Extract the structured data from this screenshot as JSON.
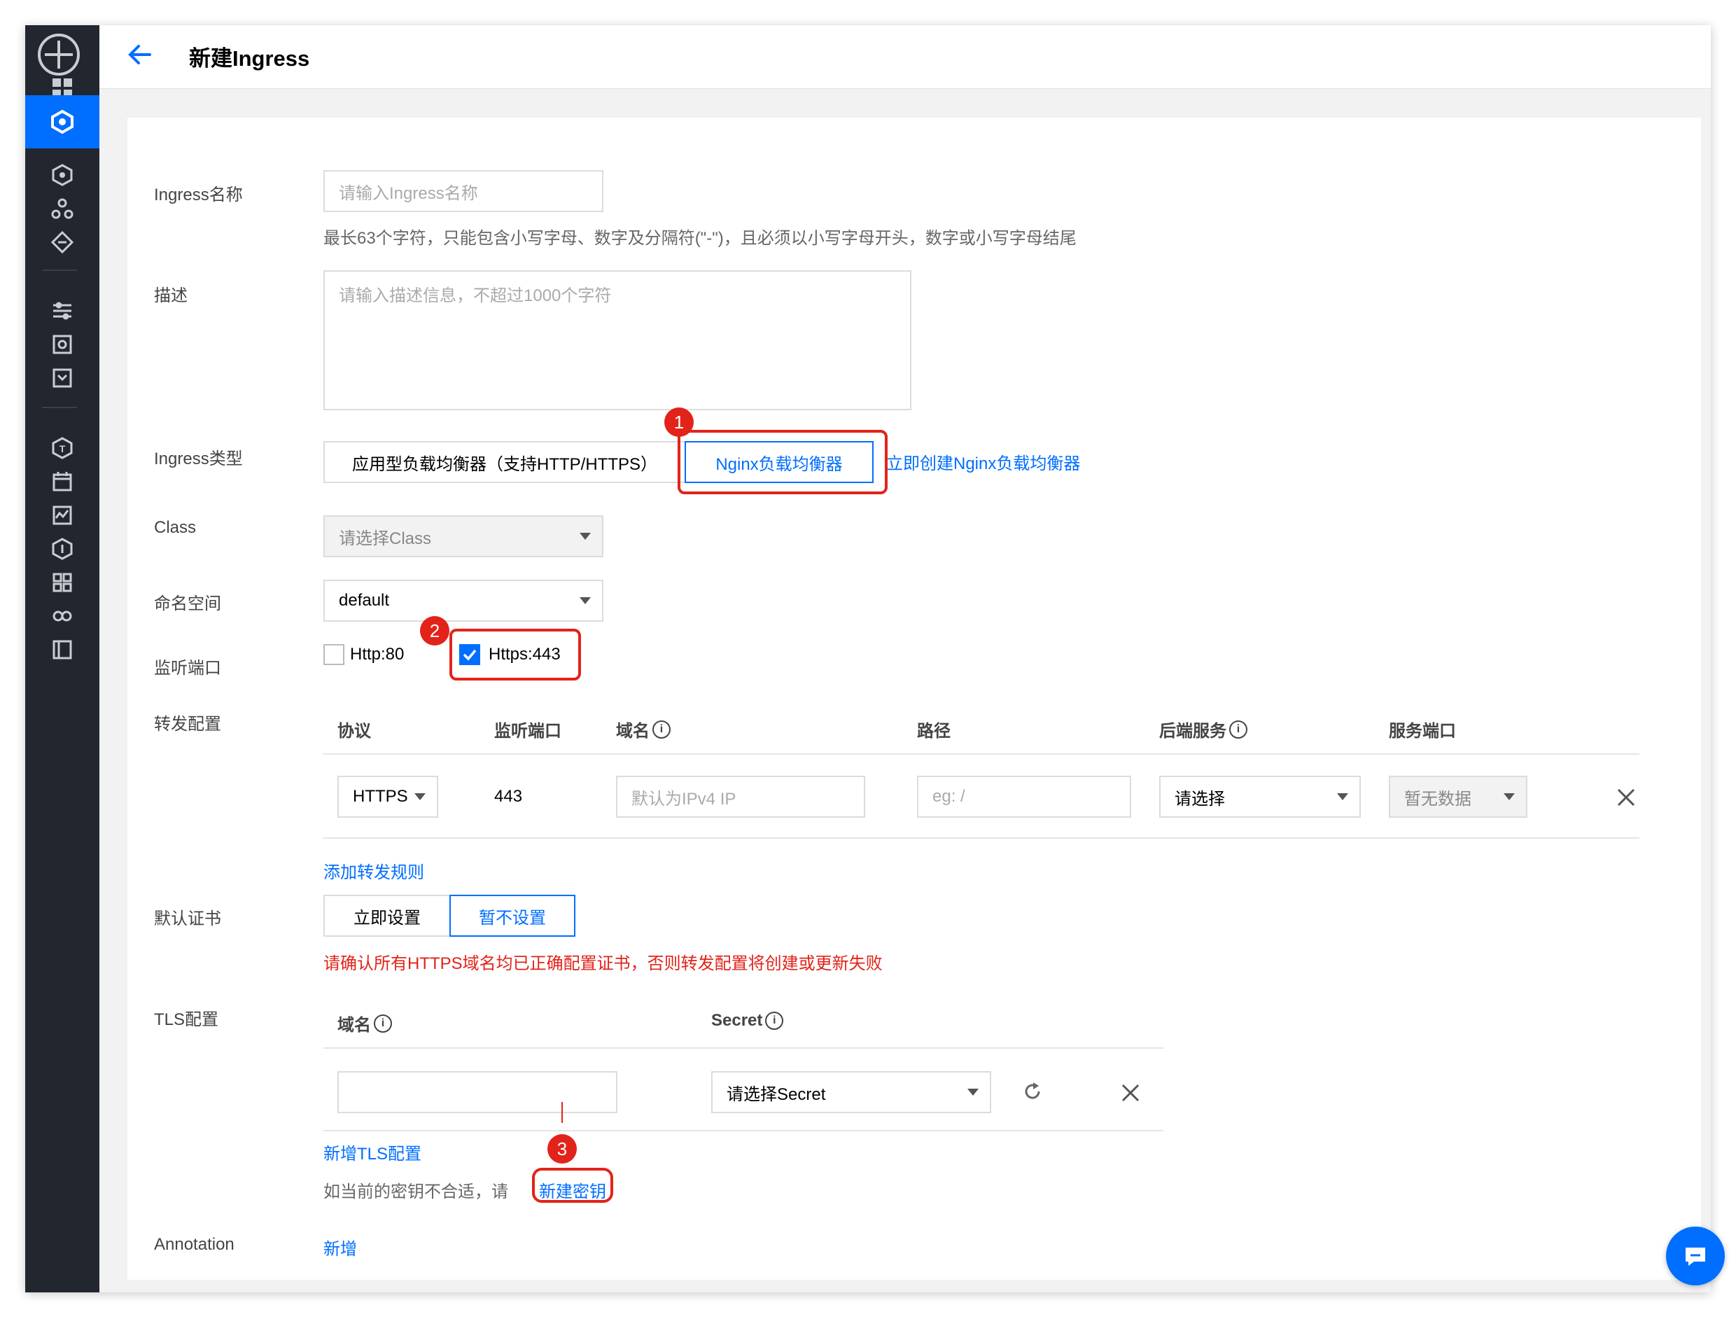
{
  "header": {
    "title": "新建Ingress"
  },
  "sidebar": {
    "items": [
      "grid-icon",
      "cube-icon",
      "cluster-icon",
      "nodes-icon",
      "network-icon",
      "sliders-icon",
      "target-icon",
      "inbox-icon",
      "shield-icon",
      "calendar-icon",
      "monitor-icon",
      "lock-icon",
      "apps-icon",
      "infinity-icon",
      "panel-icon"
    ],
    "active_index": 1
  },
  "form": {
    "name": {
      "label": "Ingress名称",
      "placeholder": "请输入Ingress名称",
      "help": "最长63个字符，只能包含小写字母、数字及分隔符(\"-\")，且必须以小写字母开头，数字或小写字母结尾"
    },
    "desc": {
      "label": "描述",
      "placeholder": "请输入描述信息，不超过1000个字符"
    },
    "type": {
      "label": "Ingress类型",
      "options": [
        "应用型负载均衡器（支持HTTP/HTTPS）",
        "Nginx负载均衡器"
      ],
      "selected": 1,
      "create_link": "立即创建Nginx负载均衡器"
    },
    "class": {
      "label": "Class",
      "placeholder": "请选择Class"
    },
    "namespace": {
      "label": "命名空间",
      "value": "default"
    },
    "ports": {
      "label": "监听端口",
      "http": "Http:80",
      "https": "Https:443",
      "http_checked": false,
      "https_checked": true
    },
    "forward": {
      "label": "转发配置",
      "headers": [
        "协议",
        "监听端口",
        "域名",
        "路径",
        "后端服务",
        "服务端口"
      ],
      "row": {
        "protocol": "HTTPS",
        "port": "443",
        "domain_placeholder": "默认为IPv4 IP",
        "path_placeholder": "eg: /",
        "service": "请选择",
        "service_port": "暂无数据"
      },
      "add_link": "添加转发规则"
    },
    "cert": {
      "label": "默认证书",
      "options": [
        "立即设置",
        "暂不设置"
      ],
      "selected": 1,
      "warning": "请确认所有HTTPS域名均已正确配置证书，否则转发配置将创建或更新失败"
    },
    "tls": {
      "label": "TLS配置",
      "headers": [
        "域名",
        "Secret"
      ],
      "secret_placeholder": "请选择Secret",
      "add_link": "新增TLS配置",
      "hint": "如当前的密钥不合适，请",
      "hint_link": "新建密钥"
    },
    "annotation": {
      "label": "Annotation",
      "add_link": "新增"
    }
  },
  "annotations": {
    "badge1": "1",
    "badge2": "2",
    "badge3": "3"
  },
  "colors": {
    "accent": "#006eff",
    "sidebar_bg": "#22262e",
    "annotation_red": "#e2231a"
  }
}
